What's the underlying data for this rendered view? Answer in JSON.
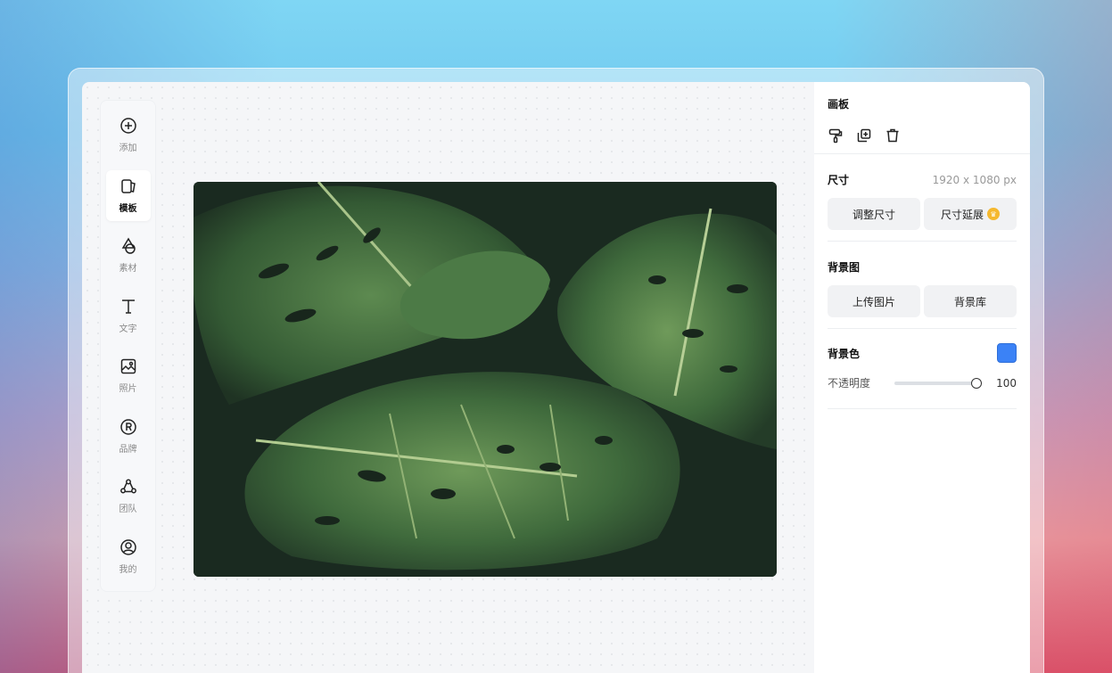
{
  "toolbar": {
    "items": [
      {
        "label": "添加",
        "icon": "plus-circle-icon"
      },
      {
        "label": "模板",
        "icon": "template-icon",
        "active": true
      },
      {
        "label": "素材",
        "icon": "shapes-icon"
      },
      {
        "label": "文字",
        "icon": "text-icon"
      },
      {
        "label": "照片",
        "icon": "photo-icon"
      },
      {
        "label": "品牌",
        "icon": "brand-icon"
      },
      {
        "label": "团队",
        "icon": "team-icon"
      },
      {
        "label": "我的",
        "icon": "user-icon"
      }
    ]
  },
  "panel": {
    "title": "画板",
    "size": {
      "label": "尺寸",
      "value": "1920 x 1080 px",
      "resize_button": "调整尺寸",
      "extend_button": "尺寸延展"
    },
    "background_image": {
      "label": "背景图",
      "upload_button": "上传图片",
      "library_button": "背景库"
    },
    "background_color": {
      "label": "背景色",
      "color": "#3b82f6",
      "opacity_label": "不透明度",
      "opacity_value": "100",
      "opacity_fraction": 1.0
    }
  }
}
